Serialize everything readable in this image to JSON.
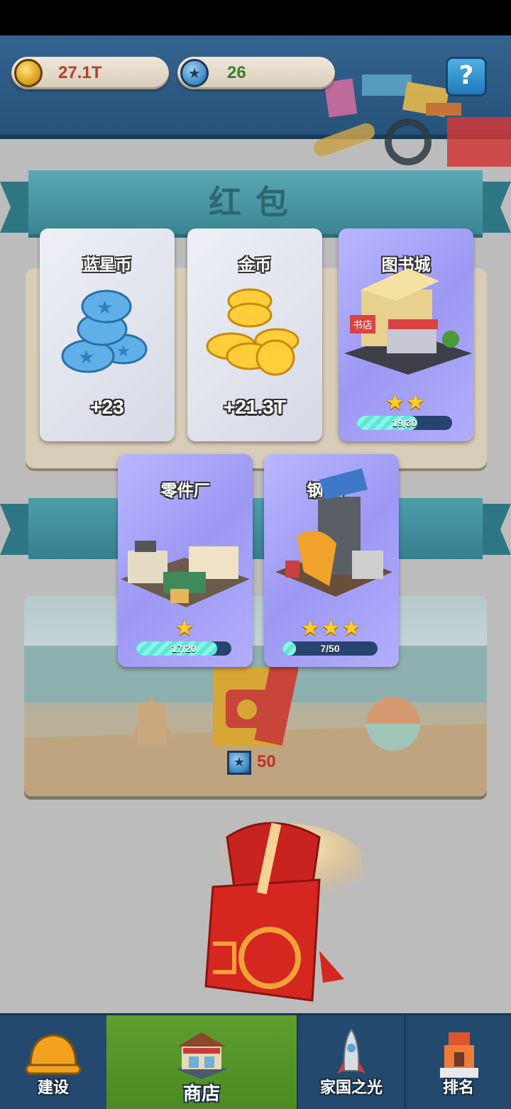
{
  "resources": {
    "gold": {
      "value": "27.1T",
      "icon": "gold-coin-icon"
    },
    "blue_star": {
      "value": "26",
      "icon": "blue-star-coin-icon"
    }
  },
  "help_label": "?",
  "section_title": "红包",
  "rewards": [
    {
      "name": "蓝星币",
      "amount": "+23",
      "type": "currency",
      "icon": "blue-star-coins-icon"
    },
    {
      "name": "金币",
      "amount": "+21.3T",
      "type": "currency",
      "icon": "gold-coins-icon"
    },
    {
      "name": "图书城",
      "type": "building",
      "stars": "★★",
      "progress_label": "19/30",
      "progress": 0.633
    },
    {
      "name": "零件厂",
      "type": "building",
      "stars": "★",
      "progress_label": "17/20",
      "progress": 0.85
    },
    {
      "name": "钢铁厂",
      "type": "building",
      "stars": "★★★",
      "progress_label": "7/50",
      "progress": 0.14
    }
  ],
  "shop_item_price": "50",
  "tabs": [
    {
      "label": "建设",
      "icon": "hard-hat-icon"
    },
    {
      "label": "商店",
      "icon": "shop-icon",
      "active": true
    },
    {
      "label": "家国之光",
      "icon": "rocket-icon"
    },
    {
      "label": "排名",
      "icon": "ranking-tower-icon"
    }
  ],
  "colors": {
    "accent_red": "#c0312b",
    "tab_active": "#5f9e2f",
    "card_purple": "#a9a5f8"
  }
}
